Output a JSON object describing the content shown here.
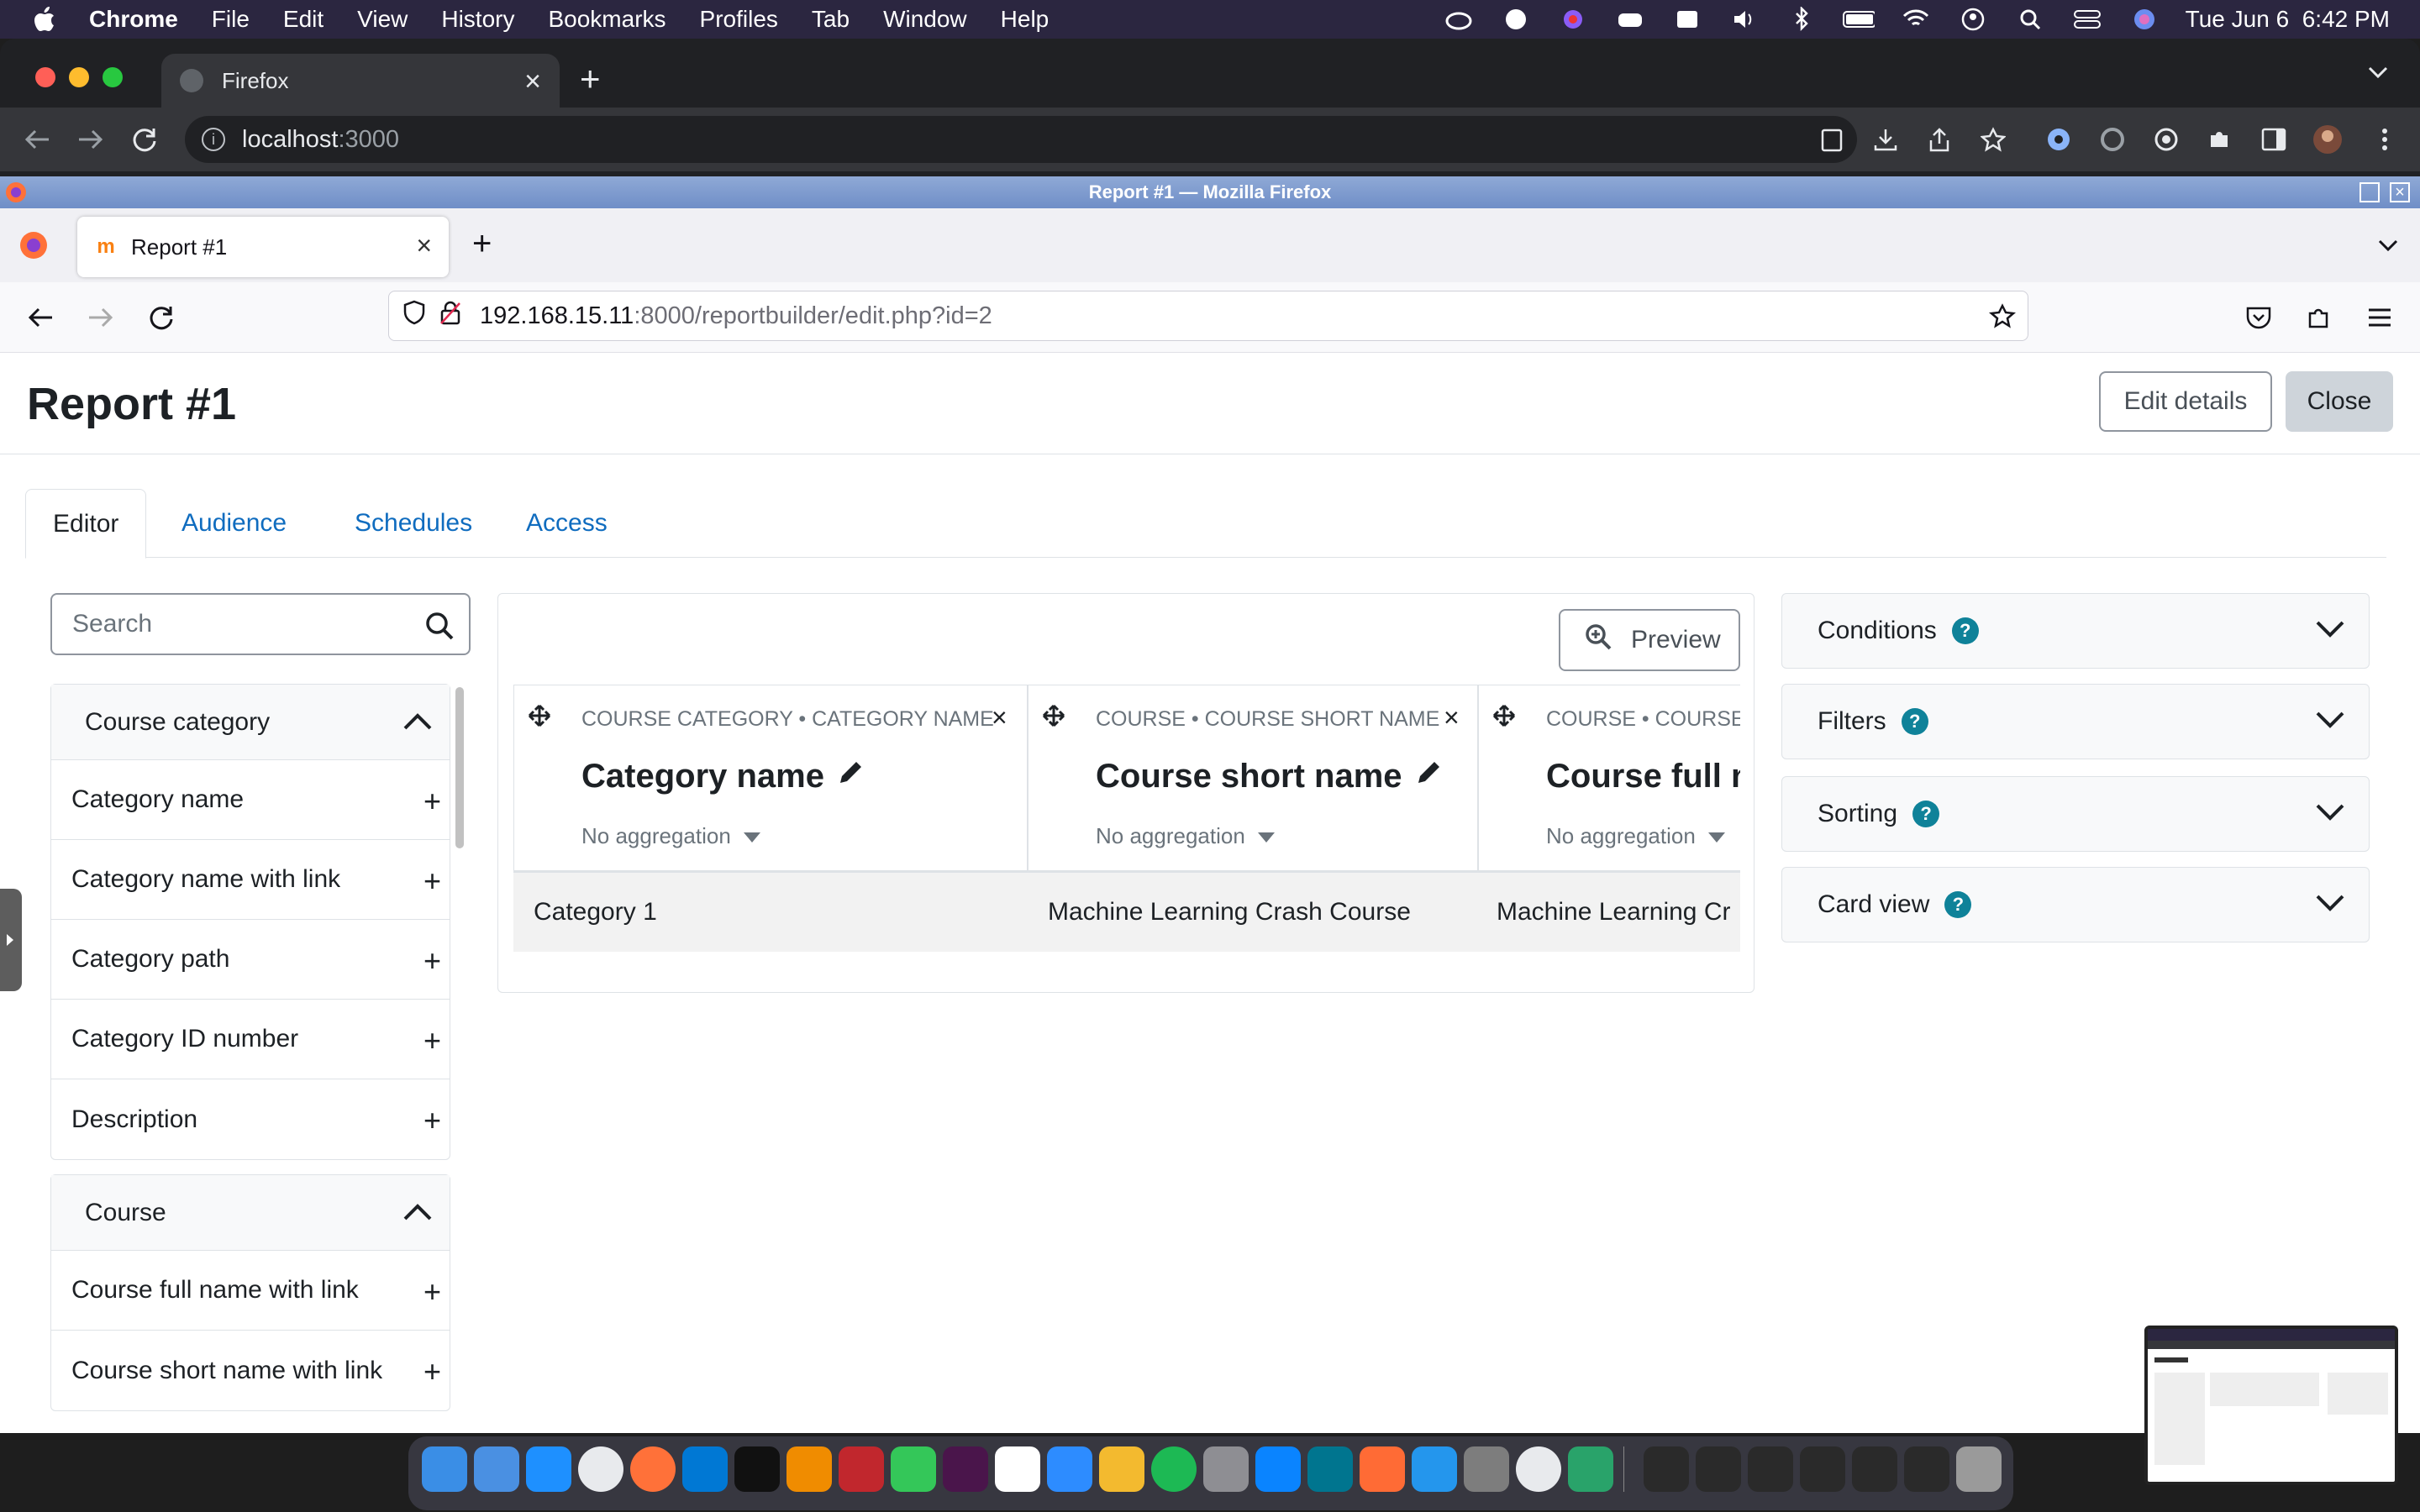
{
  "menubar": {
    "app": "Chrome",
    "items": [
      "File",
      "Edit",
      "View",
      "History",
      "Bookmarks",
      "Profiles",
      "Tab",
      "Window",
      "Help"
    ],
    "clock": "Tue Jun 6  6:42 PM"
  },
  "chrome": {
    "tab_title": "Firefox",
    "url_host": "localhost",
    "url_port": ":3000"
  },
  "firefox": {
    "window_title": "Report #1 — Mozilla Firefox",
    "tab_title": "Report #1",
    "url_host": "192.168.15.11",
    "url_rest": ":8000/reportbuilder/edit.php?id=2"
  },
  "page": {
    "title": "Report #1",
    "edit_details": "Edit details",
    "close": "Close",
    "tabs": [
      "Editor",
      "Audience",
      "Schedules",
      "Access"
    ],
    "search_placeholder": "Search",
    "sidebar": [
      {
        "title": "Course category",
        "items": [
          "Category name",
          "Category name with link",
          "Category path",
          "Category ID number",
          "Description"
        ]
      },
      {
        "title": "Course",
        "items": [
          "Course full name with link",
          "Course short name with link"
        ]
      }
    ],
    "preview": "Preview",
    "columns": [
      {
        "identifier": "COURSE CATEGORY • CATEGORY NAME",
        "name": "Category name",
        "aggregation": "No aggregation"
      },
      {
        "identifier": "COURSE • COURSE SHORT NAME",
        "name": "Course short name",
        "aggregation": "No aggregation"
      },
      {
        "identifier": "COURSE • COURSE",
        "name": "Course full n",
        "aggregation": "No aggregation"
      }
    ],
    "row": [
      "Category 1",
      "Machine Learning Crash Course",
      "Machine Learning Cr"
    ],
    "accordions": [
      "Conditions",
      "Filters",
      "Sorting",
      "Card view"
    ]
  },
  "colors": {
    "link": "#0f6cbf",
    "help_badge": "#0f8299",
    "menubar_bg": "#2b2640"
  }
}
